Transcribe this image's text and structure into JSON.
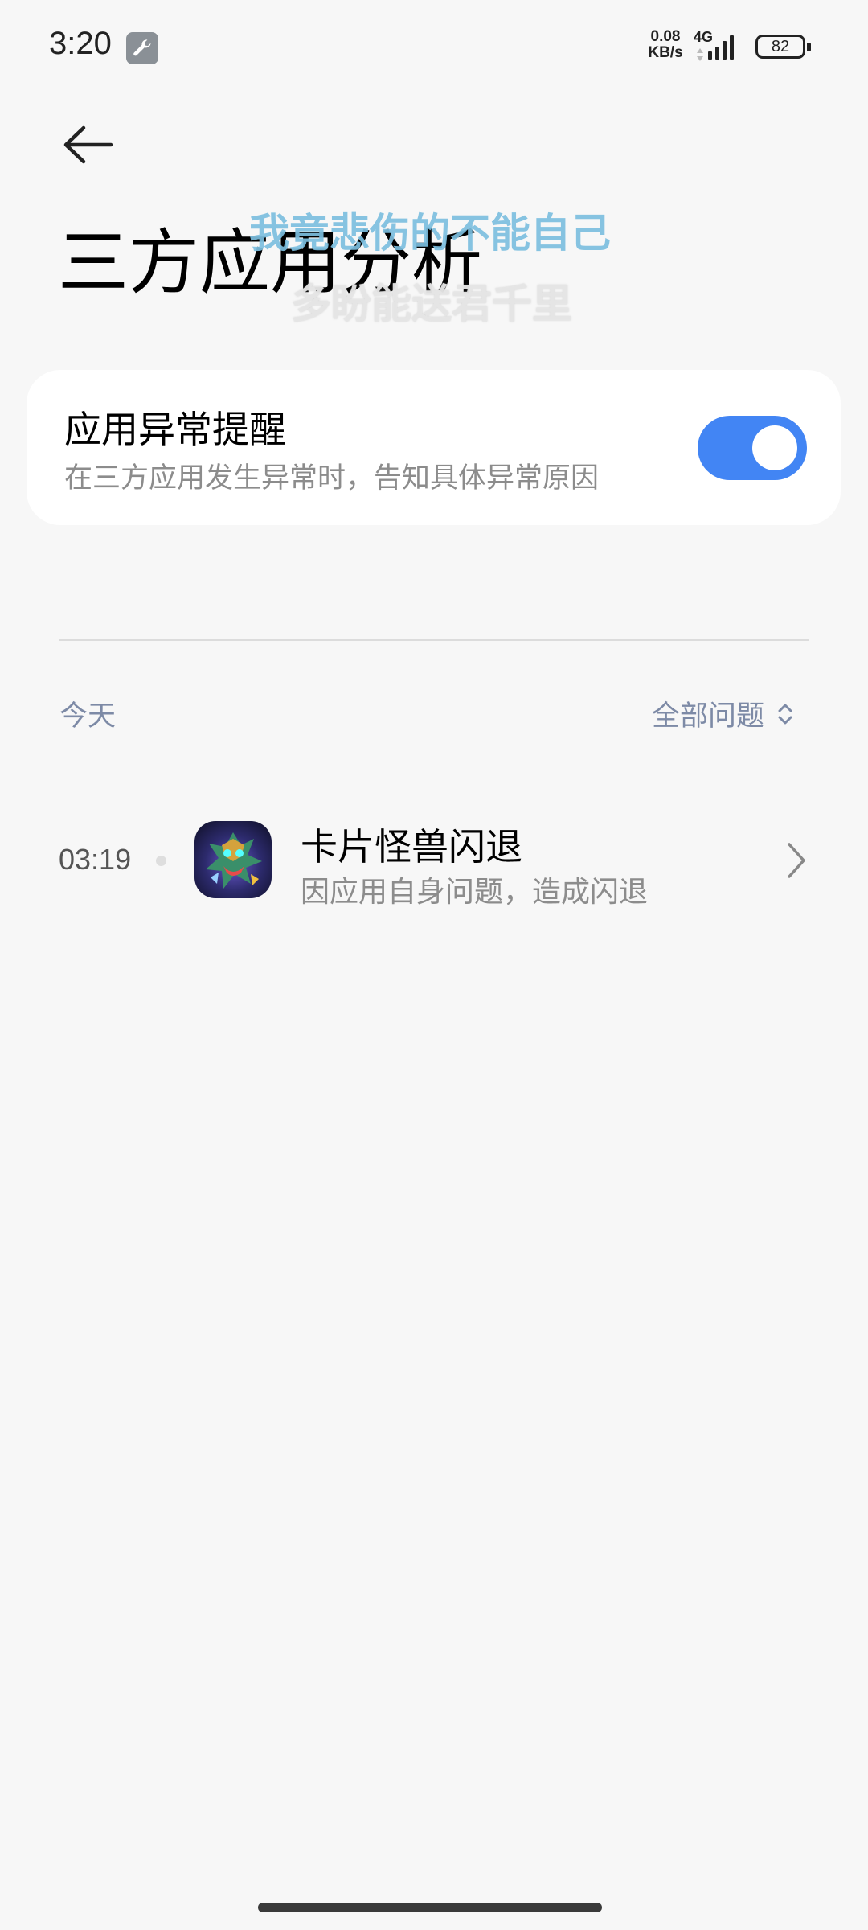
{
  "status_bar": {
    "time": "3:20",
    "tool_icon": "wrench-icon",
    "net_speed_value": "0.08",
    "net_speed_unit": "KB/s",
    "network_type": "4G",
    "battery_level": "82"
  },
  "header": {
    "back_icon": "arrow-left-icon",
    "title": "三方应用分析"
  },
  "lyrics_overlay": {
    "line1": "我竟悲伤的不能自己",
    "line2": "多盼能送君千里"
  },
  "setting_card": {
    "title": "应用异常提醒",
    "subtitle": "在三方应用发生异常时，告知具体异常原因",
    "toggle_on": true,
    "accent_color": "#4285f4"
  },
  "records_section": {
    "date_label": "今天",
    "filter_label": "全部问题",
    "filter_icon": "sort-updown-icon",
    "items": [
      {
        "time": "03:19",
        "app_icon": "game-dragon-icon",
        "title": "卡片怪兽闪退",
        "description": "因应用自身问题，造成闪退",
        "chevron_icon": "chevron-right-icon"
      }
    ]
  }
}
